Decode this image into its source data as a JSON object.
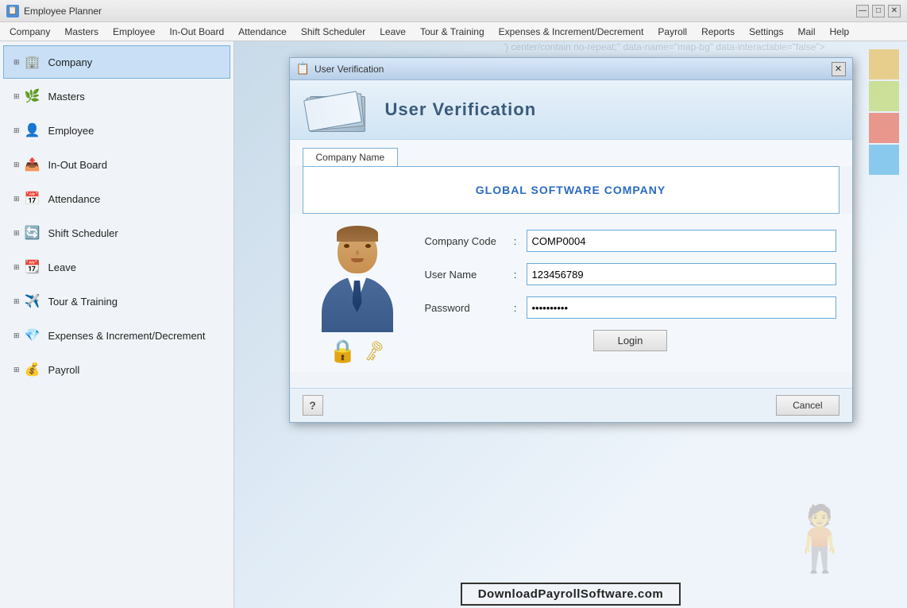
{
  "app": {
    "title": "Employee Planner",
    "icon": "📋"
  },
  "titlebar": {
    "minimize": "—",
    "maximize": "□",
    "close": "✕"
  },
  "menubar": {
    "items": [
      {
        "label": "Company"
      },
      {
        "label": "Masters"
      },
      {
        "label": "Employee"
      },
      {
        "label": "In-Out Board"
      },
      {
        "label": "Attendance"
      },
      {
        "label": "Shift Scheduler"
      },
      {
        "label": "Leave"
      },
      {
        "label": "Tour & Training"
      },
      {
        "label": "Expenses & Increment/Decrement"
      },
      {
        "label": "Payroll"
      },
      {
        "label": "Reports"
      },
      {
        "label": "Settings"
      },
      {
        "label": "Mail"
      },
      {
        "label": "Help"
      }
    ]
  },
  "sidebar": {
    "items": [
      {
        "label": "Company",
        "icon": "🏢",
        "active": true
      },
      {
        "label": "Masters",
        "icon": "🌿"
      },
      {
        "label": "Employee",
        "icon": "👤"
      },
      {
        "label": "In-Out Board",
        "icon": "📤"
      },
      {
        "label": "Attendance",
        "icon": "📅"
      },
      {
        "label": "Shift Scheduler",
        "icon": "🔄"
      },
      {
        "label": "Leave",
        "icon": "📆"
      },
      {
        "label": "Tour & Training",
        "icon": "✈️"
      },
      {
        "label": "Expenses & Increment/Decrement",
        "icon": "💎"
      },
      {
        "label": "Payroll",
        "icon": "💰"
      }
    ]
  },
  "dialog": {
    "title": "User Verification",
    "header_title": "User Verification",
    "company_tab": "Company Name",
    "company_name": "GLOBAL SOFTWARE COMPANY",
    "fields": {
      "company_code_label": "Company Code",
      "company_code_value": "COMP0004",
      "user_name_label": "User Name",
      "user_name_value": "123456789",
      "password_label": "Password",
      "password_value": "••••••••••"
    },
    "login_btn": "Login",
    "cancel_btn": "Cancel",
    "help_btn": "?",
    "colon": ":"
  },
  "watermark": {
    "text": "DownloadPayrollSoftware.com"
  }
}
